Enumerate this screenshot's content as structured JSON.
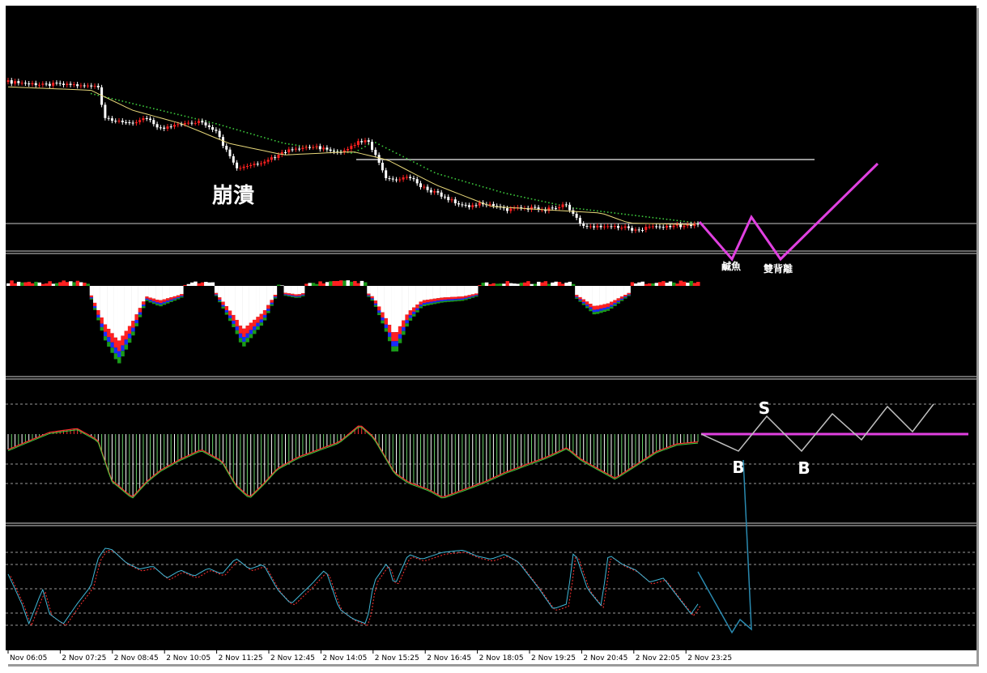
{
  "chart_data": {
    "type": "candlestick",
    "panels": [
      "price",
      "histogram",
      "oscillator",
      "stochastic"
    ],
    "colors": {
      "background": "#000000",
      "bull_candle": "#ff2020",
      "bear_candle": "#ffffff",
      "moving_average": "#e8d87a",
      "psar": "#3cc83c",
      "annotation": "#e040e0",
      "hist_red": "#ff2020",
      "hist_blue": "#1a2cff",
      "hist_green": "#1a9a1a",
      "hist_white": "#ffffff",
      "osc_bar": "#6ad06a",
      "osc_line_red": "#ff3030",
      "osc_line_green": "#40d040",
      "stoch_main": "#40b8d8",
      "stoch_signal": "#ff3030",
      "level_line": "#c8c8c8",
      "forecast_line": "#c0c0c0",
      "forecast_blue": "#2a8ab0"
    },
    "price_path": [
      [
        0,
        0.03
      ],
      [
        5,
        0.05
      ],
      [
        8,
        0.04
      ],
      [
        10,
        0.05
      ],
      [
        13,
        0.05
      ],
      [
        14,
        0.24
      ],
      [
        17,
        0.28
      ],
      [
        20,
        0.25
      ],
      [
        22,
        0.31
      ],
      [
        25,
        0.29
      ],
      [
        28,
        0.27
      ],
      [
        30,
        0.32
      ],
      [
        33,
        0.55
      ],
      [
        36,
        0.52
      ],
      [
        39,
        0.48
      ],
      [
        41,
        0.43
      ],
      [
        44,
        0.42
      ],
      [
        48,
        0.45
      ],
      [
        52,
        0.37
      ],
      [
        53,
        0.45
      ],
      [
        55,
        0.62
      ],
      [
        58,
        0.6
      ],
      [
        60,
        0.66
      ],
      [
        63,
        0.72
      ],
      [
        66,
        0.78
      ],
      [
        69,
        0.76
      ],
      [
        72,
        0.8
      ],
      [
        75,
        0.79
      ],
      [
        78,
        0.8
      ],
      [
        81,
        0.77
      ],
      [
        83,
        0.89
      ],
      [
        86,
        0.91
      ],
      [
        88,
        0.9
      ],
      [
        91,
        0.92
      ],
      [
        95,
        0.9
      ],
      [
        100,
        0.89
      ]
    ],
    "psar_path": [
      [
        12,
        0.1
      ],
      [
        20,
        0.18
      ],
      [
        30,
        0.28
      ],
      [
        40,
        0.4
      ],
      [
        50,
        0.46
      ],
      [
        53,
        0.39
      ],
      [
        62,
        0.58
      ],
      [
        72,
        0.7
      ],
      [
        82,
        0.79
      ],
      [
        92,
        0.84
      ],
      [
        100,
        0.88
      ]
    ],
    "ma_path": [
      [
        0,
        0.06
      ],
      [
        12,
        0.08
      ],
      [
        18,
        0.2
      ],
      [
        25,
        0.28
      ],
      [
        32,
        0.4
      ],
      [
        40,
        0.47
      ],
      [
        50,
        0.45
      ],
      [
        55,
        0.5
      ],
      [
        62,
        0.65
      ],
      [
        70,
        0.78
      ],
      [
        78,
        0.8
      ],
      [
        86,
        0.82
      ],
      [
        90,
        0.88
      ],
      [
        100,
        0.89
      ]
    ],
    "hist_path": [
      [
        0,
        0.02
      ],
      [
        5,
        0.05
      ],
      [
        10,
        0.01
      ],
      [
        12,
        0.15
      ],
      [
        14,
        0.65
      ],
      [
        16,
        0.95
      ],
      [
        18,
        0.62
      ],
      [
        20,
        0.18
      ],
      [
        22,
        0.25
      ],
      [
        25,
        0.15
      ],
      [
        27,
        0.02
      ],
      [
        30,
        0.1
      ],
      [
        33,
        0.55
      ],
      [
        34,
        0.75
      ],
      [
        37,
        0.45
      ],
      [
        39,
        0.1
      ],
      [
        42,
        0.15
      ],
      [
        45,
        0.05
      ],
      [
        48,
        0.02
      ],
      [
        51,
        0.02
      ],
      [
        53,
        0.2
      ],
      [
        55,
        0.6
      ],
      [
        56,
        0.85
      ],
      [
        58,
        0.45
      ],
      [
        60,
        0.25
      ],
      [
        63,
        0.2
      ],
      [
        66,
        0.18
      ],
      [
        69,
        0.1
      ],
      [
        72,
        0.05
      ],
      [
        75,
        0.05
      ],
      [
        78,
        0.05
      ],
      [
        81,
        0.05
      ],
      [
        83,
        0.2
      ],
      [
        85,
        0.35
      ],
      [
        87,
        0.3
      ],
      [
        90,
        0.12
      ],
      [
        93,
        0.03
      ],
      [
        96,
        0.05
      ],
      [
        100,
        0.02
      ]
    ],
    "osc_path": [
      [
        0,
        0.28
      ],
      [
        6,
        0.1
      ],
      [
        10,
        0.06
      ],
      [
        13,
        0.18
      ],
      [
        15,
        0.6
      ],
      [
        18,
        0.78
      ],
      [
        20,
        0.62
      ],
      [
        22,
        0.5
      ],
      [
        25,
        0.38
      ],
      [
        28,
        0.28
      ],
      [
        31,
        0.4
      ],
      [
        33,
        0.65
      ],
      [
        35,
        0.78
      ],
      [
        37,
        0.64
      ],
      [
        39,
        0.48
      ],
      [
        42,
        0.36
      ],
      [
        45,
        0.28
      ],
      [
        48,
        0.2
      ],
      [
        51,
        0.02
      ],
      [
        53,
        0.15
      ],
      [
        56,
        0.52
      ],
      [
        58,
        0.62
      ],
      [
        61,
        0.7
      ],
      [
        63,
        0.78
      ],
      [
        66,
        0.7
      ],
      [
        69,
        0.62
      ],
      [
        72,
        0.52
      ],
      [
        75,
        0.44
      ],
      [
        78,
        0.36
      ],
      [
        81,
        0.26
      ],
      [
        83,
        0.38
      ],
      [
        85,
        0.46
      ],
      [
        88,
        0.58
      ],
      [
        91,
        0.44
      ],
      [
        94,
        0.3
      ],
      [
        97,
        0.22
      ],
      [
        100,
        0.2
      ]
    ],
    "stoch_path": [
      [
        0,
        0.7
      ],
      [
        2,
        0.4
      ],
      [
        3,
        0.2
      ],
      [
        5,
        0.55
      ],
      [
        6,
        0.3
      ],
      [
        8,
        0.2
      ],
      [
        10,
        0.4
      ],
      [
        12,
        0.58
      ],
      [
        13,
        0.85
      ],
      [
        14,
        0.96
      ],
      [
        15,
        0.95
      ],
      [
        17,
        0.82
      ],
      [
        19,
        0.75
      ],
      [
        21,
        0.78
      ],
      [
        23,
        0.66
      ],
      [
        25,
        0.74
      ],
      [
        27,
        0.68
      ],
      [
        29,
        0.76
      ],
      [
        31,
        0.7
      ],
      [
        33,
        0.86
      ],
      [
        35,
        0.75
      ],
      [
        37,
        0.8
      ],
      [
        39,
        0.55
      ],
      [
        41,
        0.4
      ],
      [
        44,
        0.6
      ],
      [
        46,
        0.75
      ],
      [
        48,
        0.35
      ],
      [
        50,
        0.25
      ],
      [
        52,
        0.2
      ],
      [
        53,
        0.62
      ],
      [
        55,
        0.82
      ],
      [
        56,
        0.58
      ],
      [
        58,
        0.9
      ],
      [
        60,
        0.85
      ],
      [
        63,
        0.92
      ],
      [
        66,
        0.94
      ],
      [
        68,
        0.88
      ],
      [
        70,
        0.85
      ],
      [
        72,
        0.9
      ],
      [
        74,
        0.82
      ],
      [
        77,
        0.55
      ],
      [
        79,
        0.35
      ],
      [
        81,
        0.4
      ],
      [
        82,
        0.95
      ],
      [
        84,
        0.55
      ],
      [
        86,
        0.38
      ],
      [
        87,
        0.9
      ],
      [
        89,
        0.8
      ],
      [
        91,
        0.74
      ],
      [
        93,
        0.62
      ],
      [
        95,
        0.66
      ],
      [
        97,
        0.48
      ],
      [
        99,
        0.3
      ],
      [
        100,
        0.4
      ]
    ],
    "x_tick_labels": [
      "Nov 06:05",
      "2 Nov 07:25",
      "2 Nov 08:45",
      "2 Nov 10:05",
      "2 Nov 11:25",
      "2 Nov 12:45",
      "2 Nov 14:05",
      "2 Nov 15:25",
      "2 Nov 16:45",
      "2 Nov 18:05",
      "2 Nov 19:25",
      "2 Nov 20:45",
      "2 Nov 22:05",
      "2 Nov 23:25"
    ],
    "annotations": {
      "collapse": "崩潰",
      "salted_fish": "鹹魚",
      "double_divergence": "雙背離",
      "sell_mark": "S",
      "buy_mark_1": "B",
      "buy_mark_2": "B"
    }
  }
}
